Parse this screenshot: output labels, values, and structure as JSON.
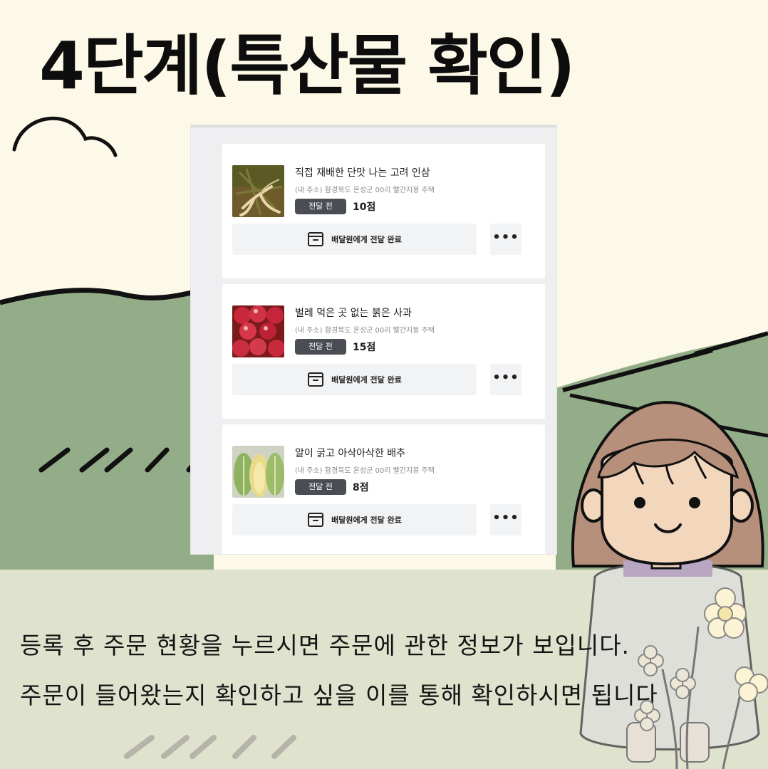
{
  "title": "4단계(특산물 확인)",
  "orders": [
    {
      "name": "직접 재배한 단맛 나는 고려 인삼",
      "address": "(내 주소) 함경북도 온성군 00리 빨간지붕 주택",
      "status": "전달 전",
      "points": "10점",
      "action_label": "배달원에게 전달 완료",
      "more_label": "•••",
      "image": "ginseng-photo"
    },
    {
      "name": "벌레 먹은 곳 없는 붉은 사과",
      "address": "(내 주소) 함경북도 온성군 00리 빨간지붕 주택",
      "status": "전달 전",
      "points": "15점",
      "action_label": "배달원에게 전달 완료",
      "more_label": "•••",
      "image": "apple-photo"
    },
    {
      "name": "알이 굵고 아삭아삭한 배추",
      "address": "(내 주소) 함경북도 온성군 00리 빨간지붕 주택",
      "status": "전달 전",
      "points": "8점",
      "action_label": "배달원에게 전달 완료",
      "more_label": "•••",
      "image": "cabbage-photo"
    }
  ],
  "caption": {
    "line1": "등록 후 주문 현황을 누르시면 주문에 관한 정보가 보입니다.",
    "line2": "주문이 들어왔는지 확인하고 싶을 이를 통해 확인하시면 됩니다"
  },
  "colors": {
    "background_cream": "#fdf9e8",
    "hill_green": "#93ad88",
    "ground": "#dfe2cd",
    "badge": "#4b4d55"
  }
}
